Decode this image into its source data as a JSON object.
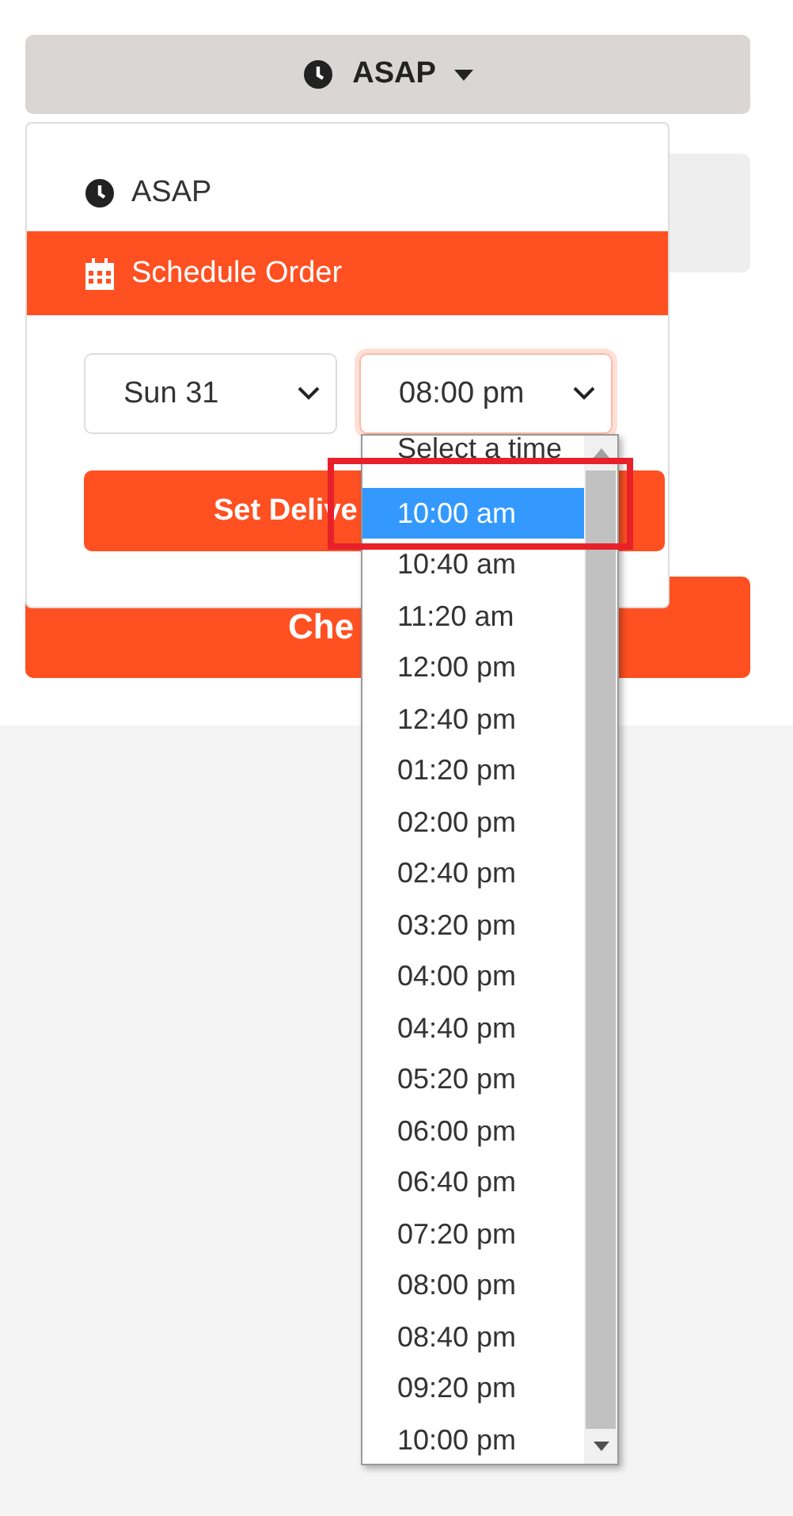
{
  "toggle": {
    "label": "ASAP"
  },
  "menu": {
    "items": [
      {
        "kind": "asap",
        "label": "ASAP",
        "selected": false
      },
      {
        "kind": "schedule",
        "label": "Schedule Order",
        "selected": true
      }
    ]
  },
  "date_select": {
    "value": "Sun 31"
  },
  "time_select": {
    "value": "08:00 pm",
    "focused": true
  },
  "set_button": {
    "label": "Set Delive"
  },
  "checkout_button": {
    "label": "Che"
  },
  "time_options": [
    {
      "label": "Select a time",
      "selected": false
    },
    {
      "label": "10:00 am",
      "selected": true
    },
    {
      "label": "10:40 am",
      "selected": false
    },
    {
      "label": "11:20 am",
      "selected": false
    },
    {
      "label": "12:00 pm",
      "selected": false
    },
    {
      "label": "12:40 pm",
      "selected": false
    },
    {
      "label": "01:20 pm",
      "selected": false
    },
    {
      "label": "02:00 pm",
      "selected": false
    },
    {
      "label": "02:40 pm",
      "selected": false
    },
    {
      "label": "03:20 pm",
      "selected": false
    },
    {
      "label": "04:00 pm",
      "selected": false
    },
    {
      "label": "04:40 pm",
      "selected": false
    },
    {
      "label": "05:20 pm",
      "selected": false
    },
    {
      "label": "06:00 pm",
      "selected": false
    },
    {
      "label": "06:40 pm",
      "selected": false
    },
    {
      "label": "07:20 pm",
      "selected": false
    },
    {
      "label": "08:00 pm",
      "selected": false
    },
    {
      "label": "08:40 pm",
      "selected": false
    },
    {
      "label": "09:20 pm",
      "selected": false
    },
    {
      "label": "10:00 pm",
      "selected": false
    }
  ]
}
